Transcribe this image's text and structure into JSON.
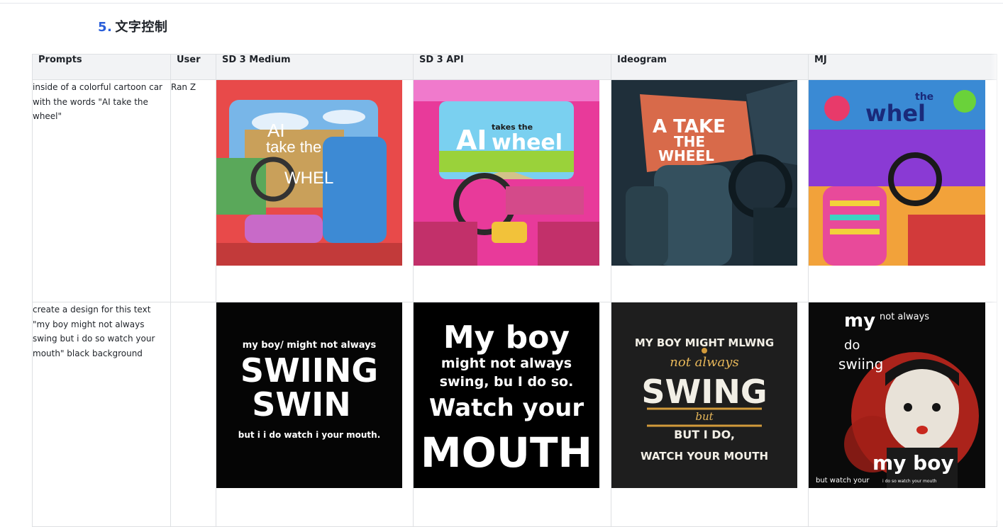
{
  "section": {
    "number": "5.",
    "title": "文字控制"
  },
  "table": {
    "headers": [
      "Prompts",
      "User",
      "SD 3 Medium",
      "SD 3 API",
      "Ideogram",
      "MJ"
    ],
    "rows": [
      {
        "prompt": "inside of a colorful cartoon car with the words \"AI take the wheel\"",
        "user": "Ran Z",
        "images": [
          {
            "text": [
              "AI",
              "take the",
              "WHEL"
            ]
          },
          {
            "text": [
              "AI",
              "takes the",
              "wheel"
            ]
          },
          {
            "text": [
              "A TAKE",
              "THE",
              "WHEEL"
            ]
          },
          {
            "text": [
              "the",
              "whel"
            ]
          }
        ]
      },
      {
        "prompt": "create a design for this text \"my boy might not always swing but i do so watch your mouth\" black background",
        "user": "",
        "images": [
          {
            "text": [
              "my boy/ might not always",
              "SWIING",
              "SWIN",
              "but i i do watch i your  mouth."
            ]
          },
          {
            "text": [
              "My  boy",
              "might not always",
              "swing, bu I  do so.",
              "Watch  your",
              "MOUTH"
            ]
          },
          {
            "text": [
              "MY BOY MIGHT MLWNG",
              "not always",
              "SWING",
              "but",
              "BUT I DO,",
              "WATCH YOUR MOUTH"
            ]
          },
          {
            "text": [
              "my",
              "not always",
              "do",
              "swiing",
              "my boy",
              "but watch your",
              "i do so watch your mouth"
            ]
          }
        ]
      }
    ]
  },
  "colors": {
    "accent": "#2b5fd9",
    "header_bg": "#f2f3f5",
    "border": "#dee0e3"
  }
}
